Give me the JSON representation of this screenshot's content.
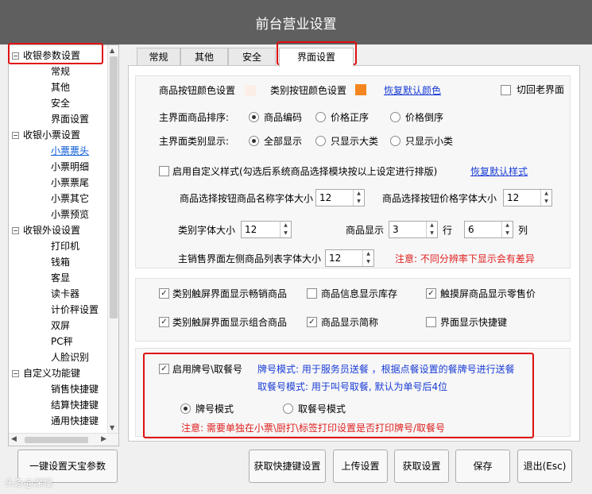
{
  "window": {
    "title": "前台营业设置"
  },
  "tree": {
    "groups": [
      {
        "label": "收银参数设置",
        "items": [
          "常规",
          "其他",
          "安全",
          "界面设置"
        ]
      },
      {
        "label": "收银小票设置",
        "items": [
          "小票票头",
          "小票明细",
          "小票票尾",
          "小票其它",
          "小票预览"
        ]
      },
      {
        "label": "收银外设设置",
        "items": [
          "打印机",
          "钱箱",
          "客显",
          "读卡器",
          "计价秤设置",
          "双屏",
          "PC秤",
          "人脸识别"
        ]
      },
      {
        "label": "自定义功能键",
        "items": [
          "销售快捷键",
          "结算快捷键",
          "通用快捷键"
        ]
      }
    ],
    "selected_item": "小票票头",
    "toggle_symbol": "−"
  },
  "tabs": [
    "常规",
    "其他",
    "安全",
    "界面设置"
  ],
  "active_tab": "界面设置",
  "colors": {
    "product_button_color": "#fbeee6",
    "category_button_color": "#f5861f",
    "highlight_border": "#e01010"
  },
  "settings": {
    "product_button_color_label": "商品按钮颜色设置",
    "category_button_color_label": "类别按钮颜色设置",
    "restore_default_color": "恢复默认颜色",
    "switch_old_ui": "切回老界面",
    "sort_label": "主界面商品排序:",
    "sort_options": [
      "商品编码",
      "价格正序",
      "价格倒序"
    ],
    "category_display_label": "主界面类别显示:",
    "category_display_options": [
      "全部显示",
      "只显示大类",
      "只显示小类"
    ],
    "custom_style_label": "启用自定义样式(勾选后系统商品选择模块按以上设定进行排版)",
    "restore_default_style": "恢复默认样式",
    "name_font_label": "商品选择按钮商品名称字体大小",
    "name_font_value": "12",
    "price_font_label": "商品选择按钮价格字体大小",
    "price_font_value": "12",
    "category_font_label": "类别字体大小",
    "category_font_value": "12",
    "product_display_label": "商品显示",
    "rows_value": "3",
    "rows_unit": "行",
    "cols_value": "6",
    "cols_unit": "列",
    "list_font_label": "主销售界面左侧商品列表字体大小",
    "list_font_value": "12",
    "resolution_note": "注意: 不同分辨率下显示会有差异"
  },
  "options": {
    "show_bestseller": "类别触屏界面显示畅销商品",
    "show_stock": "商品信息显示库存",
    "touch_retail_price": "触摸屏商品显示零售价",
    "show_combo": "类别触屏界面显示组合商品",
    "show_short_name": "商品显示简称",
    "show_shortcut": "界面显示快捷键"
  },
  "pager": {
    "enable_label": "启用牌号\\取餐号",
    "desc_line1": "牌号模式: 用于服务员送餐 ，根据点餐设置的餐牌号进行送餐",
    "desc_line2": "取餐号模式: 用于叫号取餐, 默认为单号后4位",
    "mode_options": [
      "牌号模式",
      "取餐号模式"
    ],
    "note": "注意: 需要单独在小票\\厨打\\标签打印设置是否打印牌号/取餐号"
  },
  "buttons": {
    "one_click": "一键设置天宝参数",
    "get_shortcut": "获取快捷键设置",
    "upload": "上传设置",
    "fetch": "获取设置",
    "save": "保存",
    "exit": "退出(Esc)"
  },
  "watermark": "头条@深瞳"
}
